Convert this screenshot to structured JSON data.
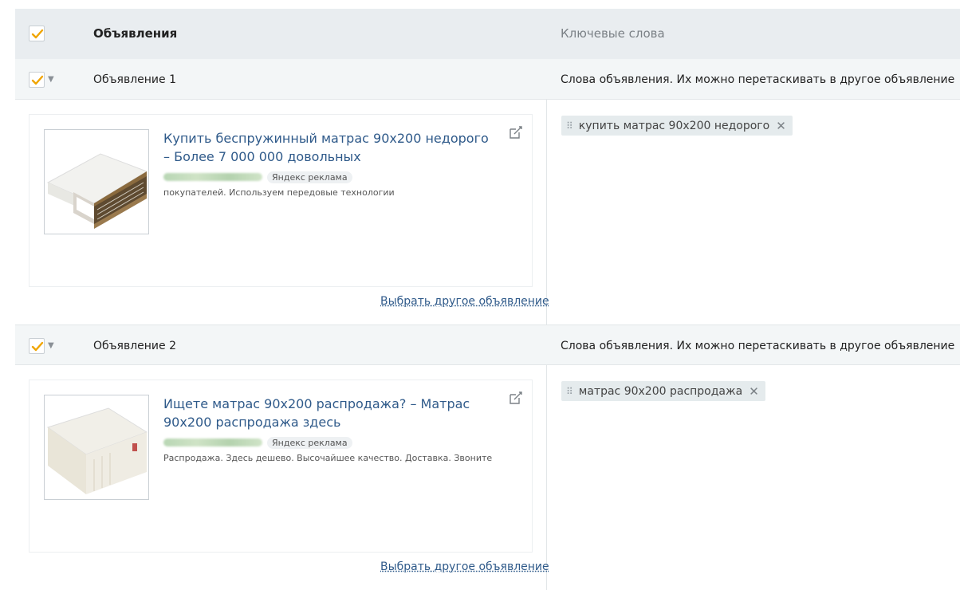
{
  "header": {
    "title": "Объявления",
    "keywords_title": "Ключевые слова"
  },
  "colors": {
    "link": "#2f5a8a",
    "check": "#f0a500",
    "header_bg": "#e9edf0"
  },
  "ads": [
    {
      "label": "Объявление 1",
      "keywords_hint": "Слова объявления. Их можно перетаскивать в другое объявление",
      "title": "Купить беспружинный матрас 90х200 недорого – Более 7 000 000 довольных",
      "badge": "Яндекс реклама",
      "text": "покупателей. Используем передовые технологии",
      "choose_link": "Выбрать другое объявление",
      "keyword": "купить матрас 90х200 недорого",
      "image": "spring-mattress-icon"
    },
    {
      "label": "Объявление 2",
      "keywords_hint": "Слова объявления. Их можно перетаскивать в другое объявление",
      "title": "Ищете матрас 90х200 распродажа? – Матрас 90х200 распродажа здесь",
      "badge": "Яндекс реклама",
      "text": "Распродажа. Здесь дешево. Высочайшее качество. Доставка. Звоните",
      "choose_link": "Выбрать другое объявление",
      "keyword": "матрас 90х200 распродажа",
      "image": "mattress-icon"
    }
  ]
}
